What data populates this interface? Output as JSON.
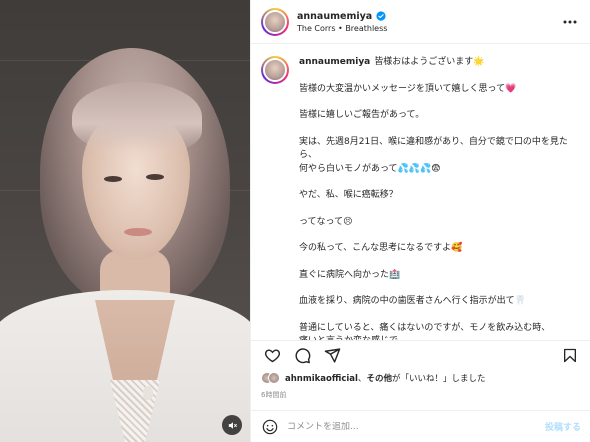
{
  "post": {
    "username": "annaumemiya",
    "song": "The Corrs • Breathless",
    "caption_lines": [
      "皆様おはようございます🌟",
      "皆様の大変温かいメッセージを頂いて嬉しく思って💗",
      "皆様に嬉しいご報告があって。",
      "実は、先週8月21日、喉に違和感があり、自分で鏡で口の中を見たら、\n何やら白いモノがあって💦💦💦😨",
      "やだ、私、喉に癌転移？",
      "ってなって😣",
      "今の私って、こんな思考になるですよ🥰",
      "直ぐに病院へ向かった🏥",
      "血液を採り、病院の中の歯医者さんへ行く指示が出て🦷",
      "普通にしていると、痛くはないのですが、モノを飲み込む時、\n痛いと言うか変な感じで。。。"
    ],
    "likes_user": "ahnmikaofficial",
    "likes_sep": "、",
    "likes_others": "その他",
    "likes_suffix": "が「いいね！」しました",
    "time_ago": "6時間前"
  },
  "comment": {
    "placeholder": "コメントを追加...",
    "post_label": "投稿する"
  },
  "icons": {
    "verified": "verified-badge-icon",
    "more": "more-options-icon",
    "like": "heart-icon",
    "comment": "comment-icon",
    "share": "share-icon",
    "save": "bookmark-icon",
    "emoji": "emoji-icon",
    "mute": "mute-icon"
  },
  "colors": {
    "verified": "#0095f6",
    "story_ring": [
      "#f9ce34",
      "#ee2a7b",
      "#6228d7"
    ],
    "post_button_disabled": "#b2dffc"
  }
}
